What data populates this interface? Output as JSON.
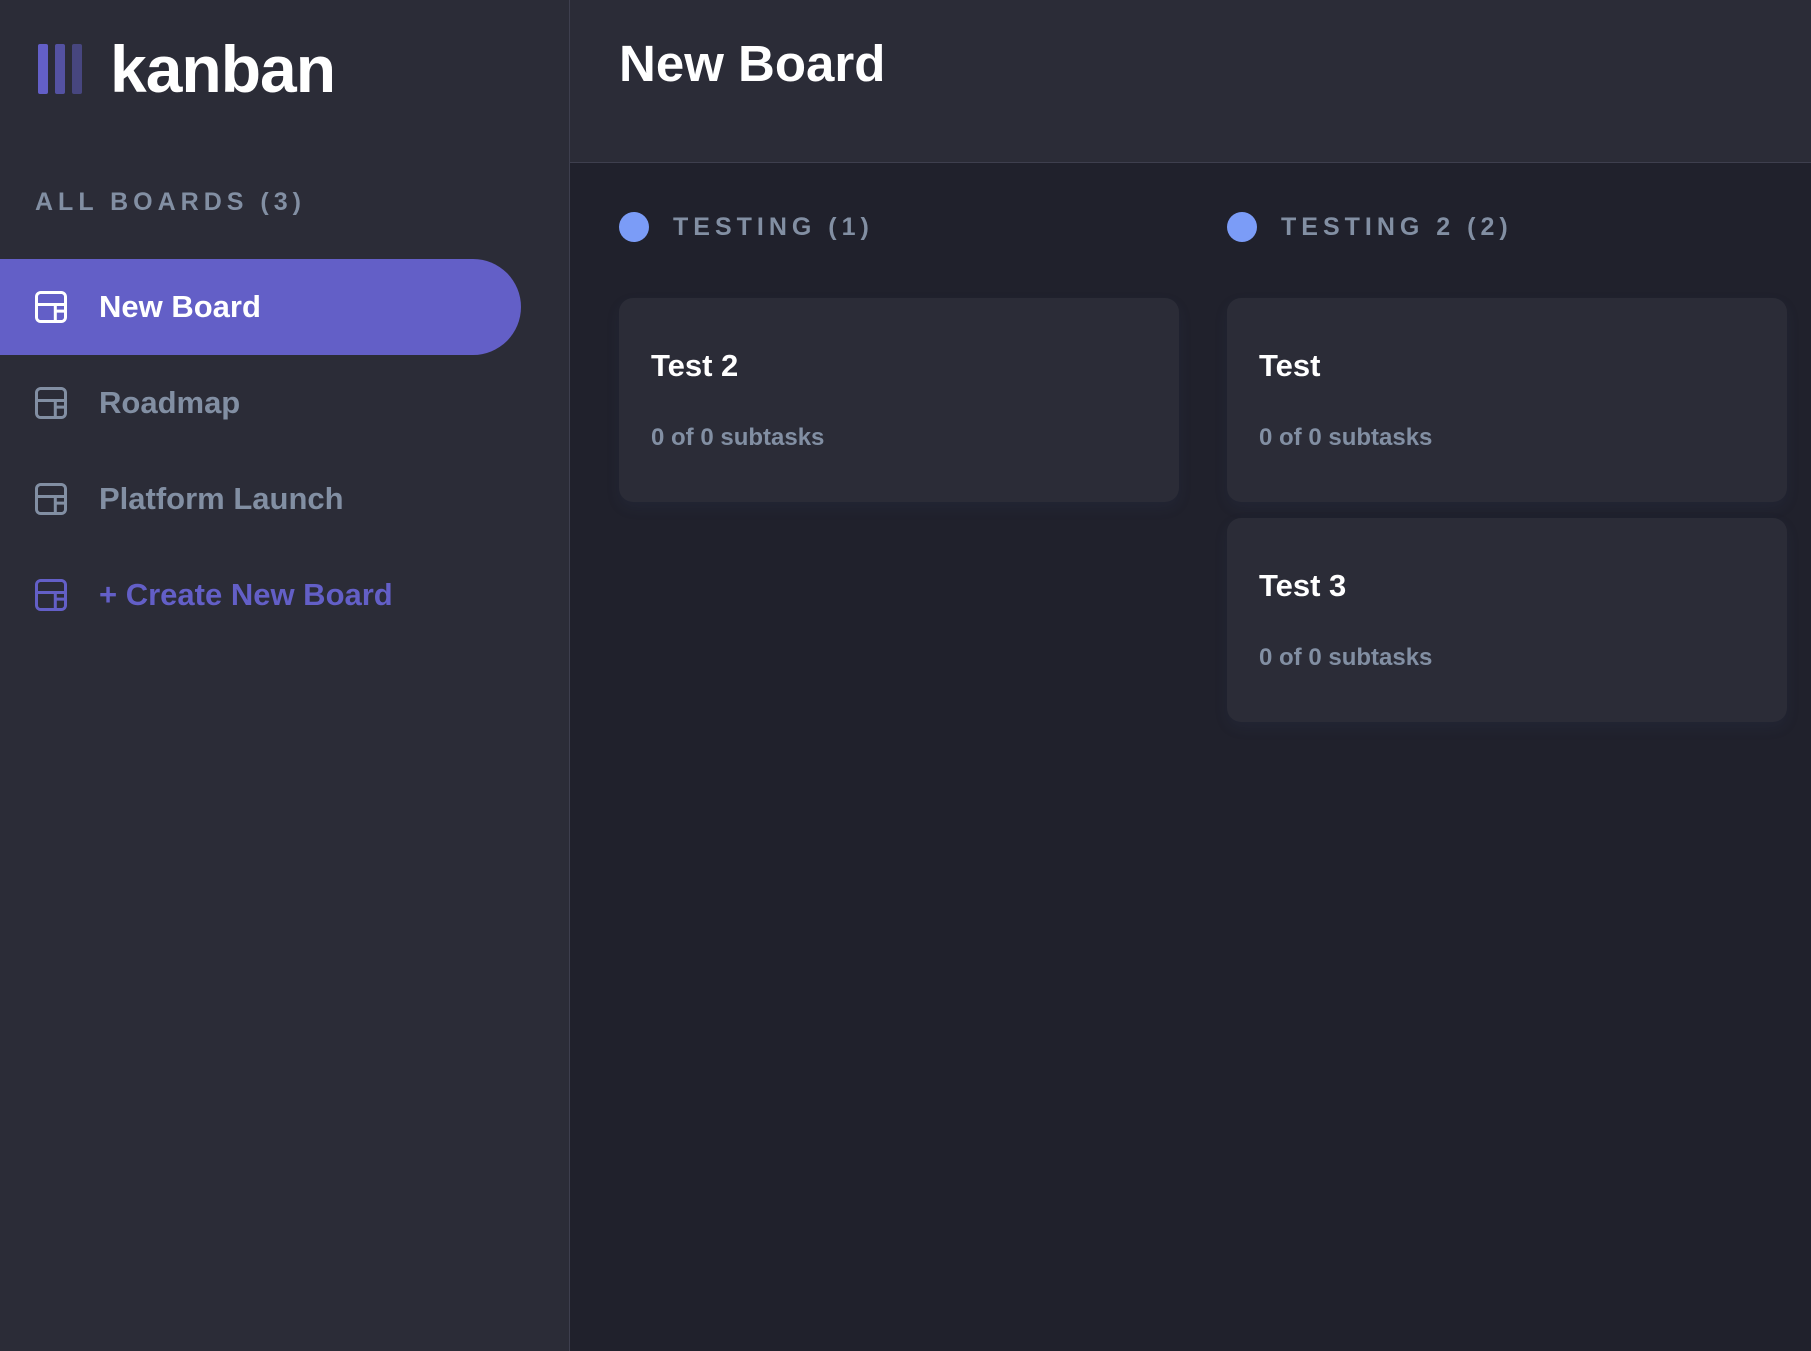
{
  "app": {
    "logo_text": "kanban"
  },
  "sidebar": {
    "heading": "ALL BOARDS (3)",
    "boards": [
      {
        "label": "New Board",
        "active": true
      },
      {
        "label": "Roadmap",
        "active": false
      },
      {
        "label": "Platform Launch",
        "active": false
      }
    ],
    "create_label": "+ Create New Board"
  },
  "header": {
    "title": "New Board"
  },
  "columns": [
    {
      "title": "TESTING (1)",
      "dot_color": "#7b9cf7",
      "cards": [
        {
          "title": "Test 2",
          "subtasks": "0 of 0 subtasks"
        }
      ]
    },
    {
      "title": "TESTING 2 (2)",
      "dot_color": "#7b9cf7",
      "cards": [
        {
          "title": "Test",
          "subtasks": "0 of 0 subtasks"
        },
        {
          "title": "Test 3",
          "subtasks": "0 of 0 subtasks"
        }
      ]
    }
  ],
  "colors": {
    "accent": "#635fc7",
    "sidebar_bg": "#2b2c37",
    "board_bg": "#20212c",
    "muted_text": "#828fa3"
  },
  "icons": {
    "logo": "kanban-logo-icon",
    "board": "board-icon"
  }
}
